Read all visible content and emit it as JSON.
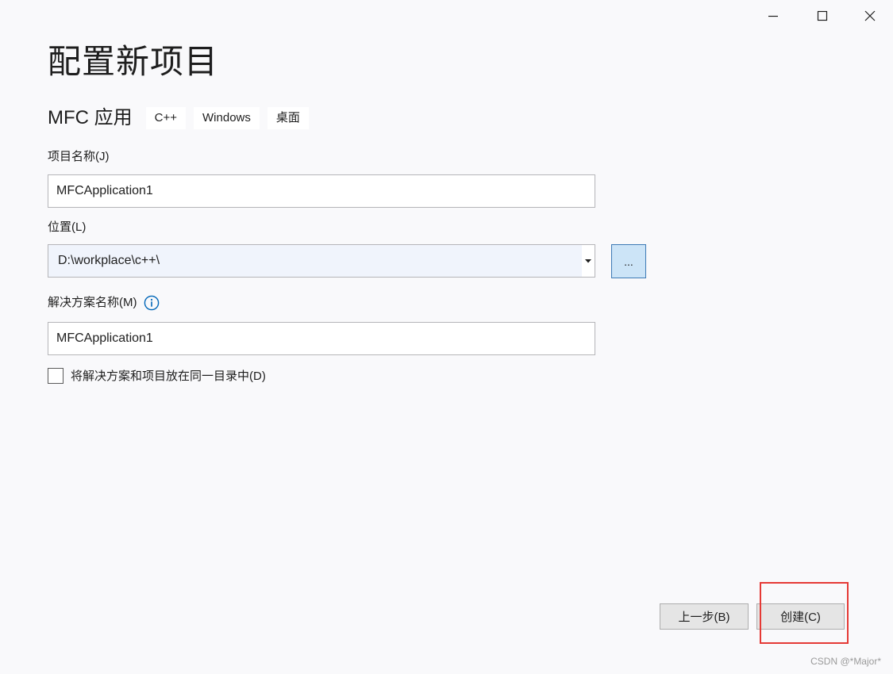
{
  "window": {
    "controls": {
      "minimize_icon": "minimize-icon",
      "maximize_icon": "maximize-icon",
      "close_icon": "close-icon"
    }
  },
  "page": {
    "title": "配置新项目"
  },
  "template": {
    "name": "MFC 应用",
    "tags": [
      "C++",
      "Windows",
      "桌面"
    ]
  },
  "form": {
    "project_name": {
      "label": "项目名称(J)",
      "value": "MFCApplication1"
    },
    "location": {
      "label": "位置(L)",
      "value": "D:\\workplace\\c++\\",
      "browse_label": "..."
    },
    "solution_name": {
      "label": "解决方案名称(M)",
      "value": "MFCApplication1",
      "info_icon": "info-icon"
    },
    "same_directory": {
      "label": "将解决方案和项目放在同一目录中(D)",
      "checked": false
    }
  },
  "footer": {
    "back_label": "上一步(B)",
    "create_label": "创建(C)"
  },
  "watermark": "CSDN @*Major*",
  "colors": {
    "background": "#f9f9fb",
    "highlight": "#e53935",
    "browse_button_bg": "#cce4f7",
    "info_icon": "#0066b8"
  }
}
